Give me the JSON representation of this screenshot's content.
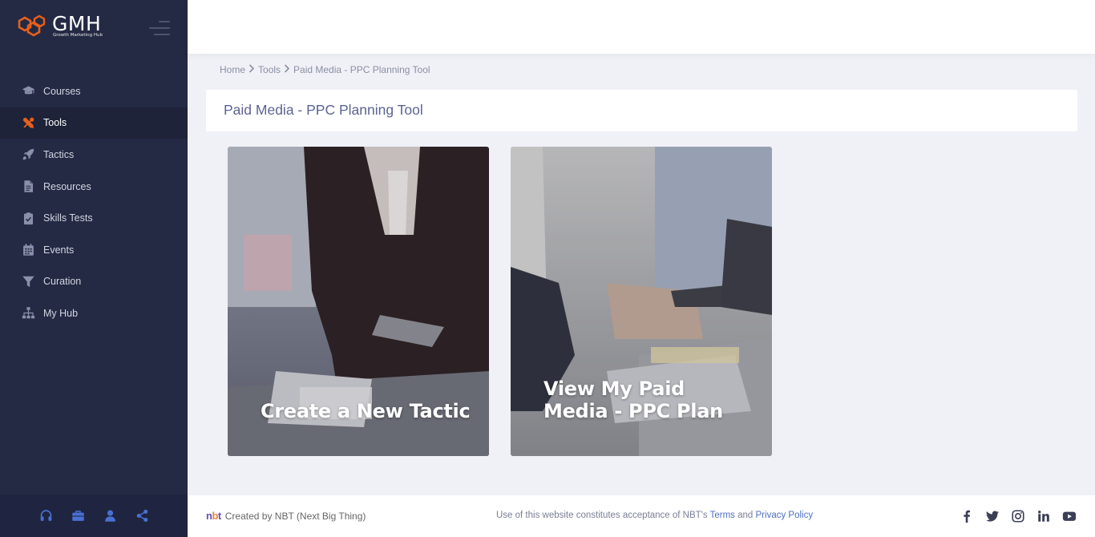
{
  "brand": {
    "name": "GMH",
    "tagline": "Growth Marketing Hub",
    "accent_color": "#e8601c"
  },
  "sidebar": {
    "items": [
      {
        "label": "Courses",
        "icon": "graduation-cap-icon",
        "active": false
      },
      {
        "label": "Tools",
        "icon": "tools-icon",
        "active": true
      },
      {
        "label": "Tactics",
        "icon": "rocket-icon",
        "active": false
      },
      {
        "label": "Resources",
        "icon": "document-icon",
        "active": false
      },
      {
        "label": "Skills Tests",
        "icon": "clipboard-check-icon",
        "active": false
      },
      {
        "label": "Events",
        "icon": "calendar-icon",
        "active": false
      },
      {
        "label": "Curation",
        "icon": "filter-icon",
        "active": false
      },
      {
        "label": "My Hub",
        "icon": "sitemap-icon",
        "active": false
      }
    ],
    "footer_icons": [
      "headphones-icon",
      "briefcase-icon",
      "user-icon",
      "share-icon"
    ]
  },
  "breadcrumb": {
    "items": [
      "Home",
      "Tools",
      "Paid Media - PPC Planning Tool"
    ]
  },
  "page": {
    "title": "Paid Media - PPC Planning Tool"
  },
  "cards": [
    {
      "title": "Create a New Tactic"
    },
    {
      "title": "View My Paid Media - PPC Plan"
    }
  ],
  "footer": {
    "logo": "nbt",
    "created_by": "Created by  NBT (Next Big Thing)",
    "notice_prefix": "Use of this website constitutes acceptance of NBT's ",
    "terms_label": "Terms",
    "and_label": " and ",
    "privacy_label": "Privacy Policy",
    "social_icons": [
      "facebook-icon",
      "twitter-icon",
      "instagram-icon",
      "linkedin-icon",
      "youtube-icon"
    ]
  }
}
